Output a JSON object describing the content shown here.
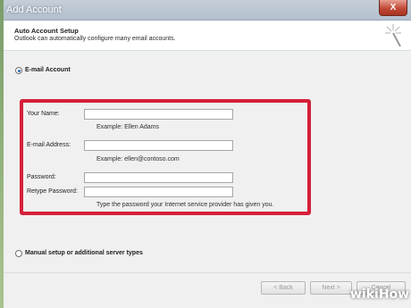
{
  "window": {
    "title": "Add Account",
    "close_label": "X"
  },
  "header": {
    "title": "Auto Account Setup",
    "subtitle": "Outlook can automatically configure many email accounts."
  },
  "email_account": {
    "option_label": "E-mail Account",
    "selected": true,
    "fields": {
      "name_label": "Your Name:",
      "name_value": "",
      "name_hint": "Example: Ellen Adams",
      "email_label": "E-mail Address:",
      "email_value": "",
      "email_hint": "Example: ellen@contoso.com",
      "password_label": "Password:",
      "retype_label": "Retype Password:",
      "password_hint": "Type the password your Internet service provider has given you."
    }
  },
  "manual_setup": {
    "option_label": "Manual setup or additional server types",
    "selected": false
  },
  "footer": {
    "back_label": "< Back",
    "next_label": "Next >",
    "cancel_label": "Cancel"
  },
  "watermark": {
    "part1": "wiki",
    "part2": "How"
  },
  "colors": {
    "highlight": "#d61f3a",
    "title_bar": "#b3c0cd",
    "close_button": "#c14a38"
  }
}
